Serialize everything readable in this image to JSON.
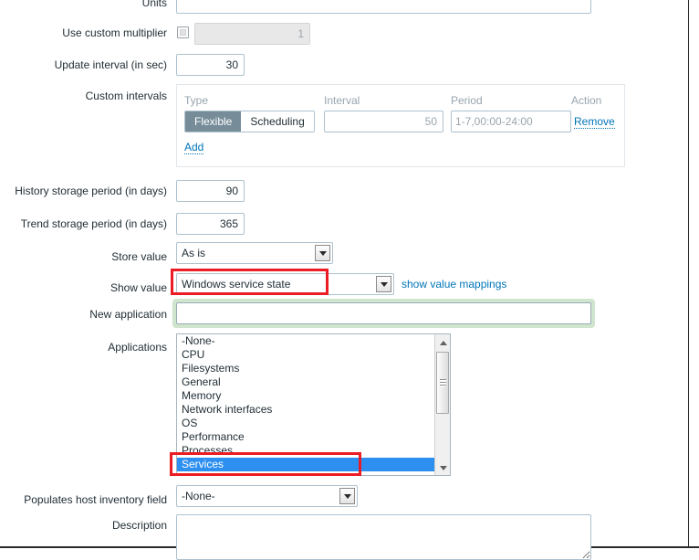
{
  "form": {
    "units": {
      "label": "Units",
      "value": "",
      "placeholder": ""
    },
    "use_custom_multiplier": {
      "label": "Use custom multiplier",
      "checked": false,
      "value": "1",
      "disabled": true
    },
    "update_interval": {
      "label": "Update interval (in sec)",
      "value": "30"
    },
    "custom_intervals": {
      "label": "Custom intervals",
      "headers": {
        "type": "Type",
        "interval": "Interval",
        "period": "Period",
        "action": "Action"
      },
      "rows": [
        {
          "type_options": [
            "Flexible",
            "Scheduling"
          ],
          "type_selected": "Flexible",
          "interval": "50",
          "period": "1-7,00:00-24:00",
          "action_label": "Remove"
        }
      ],
      "add_label": "Add"
    },
    "history_storage_period": {
      "label": "History storage period (in days)",
      "value": "90"
    },
    "trend_storage_period": {
      "label": "Trend storage period (in days)",
      "value": "365"
    },
    "store_value": {
      "label": "Store value",
      "selected": "As is"
    },
    "show_value": {
      "label": "Show value",
      "selected": "Windows service state",
      "mappings_link": "show value mappings"
    },
    "new_application": {
      "label": "New application",
      "value": "",
      "placeholder": ""
    },
    "applications": {
      "label": "Applications",
      "items": [
        {
          "label": "-None-",
          "selected": false
        },
        {
          "label": "CPU",
          "selected": false
        },
        {
          "label": "Filesystems",
          "selected": false
        },
        {
          "label": "General",
          "selected": false
        },
        {
          "label": "Memory",
          "selected": false
        },
        {
          "label": "Network interfaces",
          "selected": false
        },
        {
          "label": "OS",
          "selected": false
        },
        {
          "label": "Performance",
          "selected": false
        },
        {
          "label": "Processes",
          "selected": false
        },
        {
          "label": "Services",
          "selected": true
        }
      ]
    },
    "populates_host_inventory_field": {
      "label": "Populates host inventory field",
      "selected": "-None-"
    },
    "description": {
      "label": "Description",
      "value": "",
      "placeholder": ""
    }
  },
  "annotations": {
    "highlight_color": "#ec1c24",
    "focus_color": "#cfe5cd",
    "selection_color": "#2d8ff0",
    "link_color": "#0275b8",
    "active_segment_color": "#768d99"
  }
}
